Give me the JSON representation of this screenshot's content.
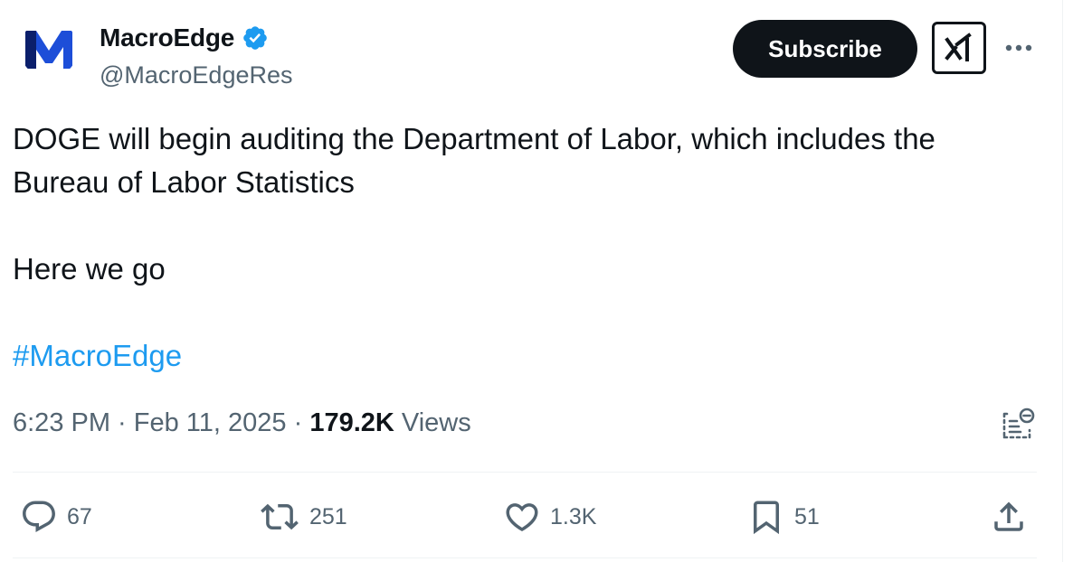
{
  "author": {
    "display_name": "MacroEdge",
    "handle": "@MacroEdgeRes",
    "avatar_letter": "M",
    "avatar_color": "#1d4ed8",
    "verified_icon": "verified-badge-icon",
    "verified_color": "#1d9bf0"
  },
  "header": {
    "subscribe_label": "Subscribe",
    "grok_icon": "grok-icon",
    "more_icon": "more-options-icon"
  },
  "tweet": {
    "line1": "DOGE will begin auditing the Department of Labor, which includes the",
    "line2": "Bureau of Labor Statistics",
    "line3": "Here we go",
    "hashtag": "#MacroEdge",
    "hashtag_color": "#1d9bf0"
  },
  "meta": {
    "time": "6:23 PM",
    "separator": " · ",
    "date": "Feb 11, 2025",
    "views_count": "179.2K",
    "views_label": "Views",
    "notes_icon": "community-notes-icon"
  },
  "actions": {
    "reply_count": "67",
    "retweet_count": "251",
    "like_count": "1.3K",
    "bookmark_count": "51",
    "share_icon": "share-icon"
  }
}
